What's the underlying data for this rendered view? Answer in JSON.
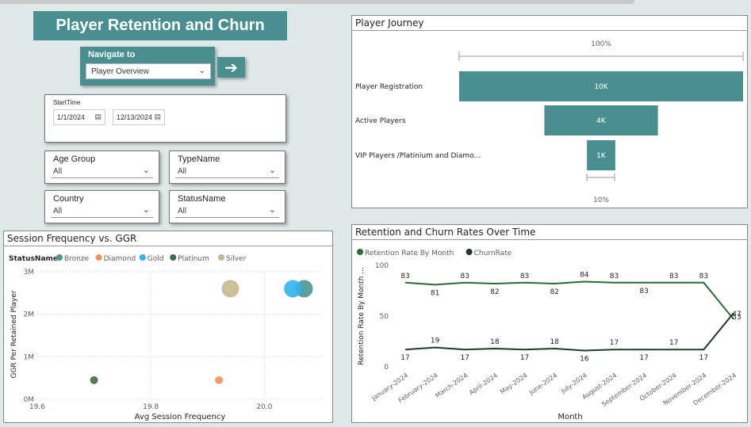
{
  "header": {
    "title": "Player Retention and Churn"
  },
  "nav": {
    "label": "Navigate to",
    "selected": "Player Overview",
    "go_icon": "arrow-right-icon"
  },
  "date_slicer": {
    "label": "StartTime",
    "start": "1/1/2024",
    "end": "12/13/2024"
  },
  "slicers": [
    {
      "label": "Age Group",
      "value": "All"
    },
    {
      "label": "TypeName",
      "value": "All"
    },
    {
      "label": "Country",
      "value": "All"
    },
    {
      "label": "StatusName",
      "value": "All"
    }
  ],
  "colors": {
    "accent": "#4a8f8f",
    "bronze": "#4a9590",
    "diamond": "#f2905a",
    "gold": "#2eb4f0",
    "platinum": "#3f6e42",
    "silver": "#c8b88c",
    "retention": "#2b6b36",
    "churn": "#1f3d24"
  },
  "funnel": {
    "title": "Player Journey",
    "top_pct": "100%",
    "bottom_pct": "10%",
    "chart_data": {
      "type": "bar",
      "categories": [
        "Player Registration",
        "Active Players",
        "VIP Players /Platinium and Diamo..."
      ],
      "values": [
        10000,
        4000,
        1000
      ],
      "labels": [
        "10K",
        "4K",
        "1K"
      ]
    }
  },
  "scatter": {
    "title": "Session Frequency vs. GGR",
    "legend_title": "StatusName",
    "chart_data": {
      "type": "scatter",
      "xlabel": "Avg Session Frequency",
      "ylabel": "GGR Per Retained Player",
      "xlim": [
        19.6,
        20.1
      ],
      "ylim": [
        0,
        3000000
      ],
      "xticks": [
        "19.6",
        "19.8",
        "20.0"
      ],
      "yticks": [
        "0M",
        "1M",
        "2M",
        "3M"
      ],
      "series": [
        {
          "name": "Bronze",
          "points": [
            [
              20.07,
              2600000
            ]
          ]
        },
        {
          "name": "Diamond",
          "points": [
            [
              19.92,
              450000
            ]
          ]
        },
        {
          "name": "Gold",
          "points": [
            [
              20.05,
              2600000
            ]
          ]
        },
        {
          "name": "Platinum",
          "points": [
            [
              19.7,
              450000
            ]
          ]
        },
        {
          "name": "Silver",
          "points": [
            [
              19.94,
              2600000
            ]
          ]
        }
      ]
    }
  },
  "line": {
    "title": "Retention and Churn Rates Over Time",
    "chart_data": {
      "type": "line",
      "xlabel": "Month",
      "ylabel": "Retention Rate By Month ...",
      "ylim": [
        0,
        100
      ],
      "yticks": [
        "0",
        "50",
        "100"
      ],
      "categories": [
        "January-2024",
        "February-2024",
        "March-2024",
        "April-2024",
        "May-2024",
        "June-2024",
        "July-2024",
        "August-2024",
        "September-2024",
        "October-2024",
        "November-2024",
        "December-2024"
      ],
      "series": [
        {
          "name": "Retention Rate By Month",
          "values": [
            83,
            81,
            83,
            82,
            83,
            82,
            84,
            83,
            83,
            83,
            83,
            47
          ]
        },
        {
          "name": "ChurnRate",
          "values": [
            17,
            19,
            17,
            18,
            17,
            18,
            16,
            17,
            17,
            17,
            17,
            53
          ]
        }
      ]
    }
  }
}
